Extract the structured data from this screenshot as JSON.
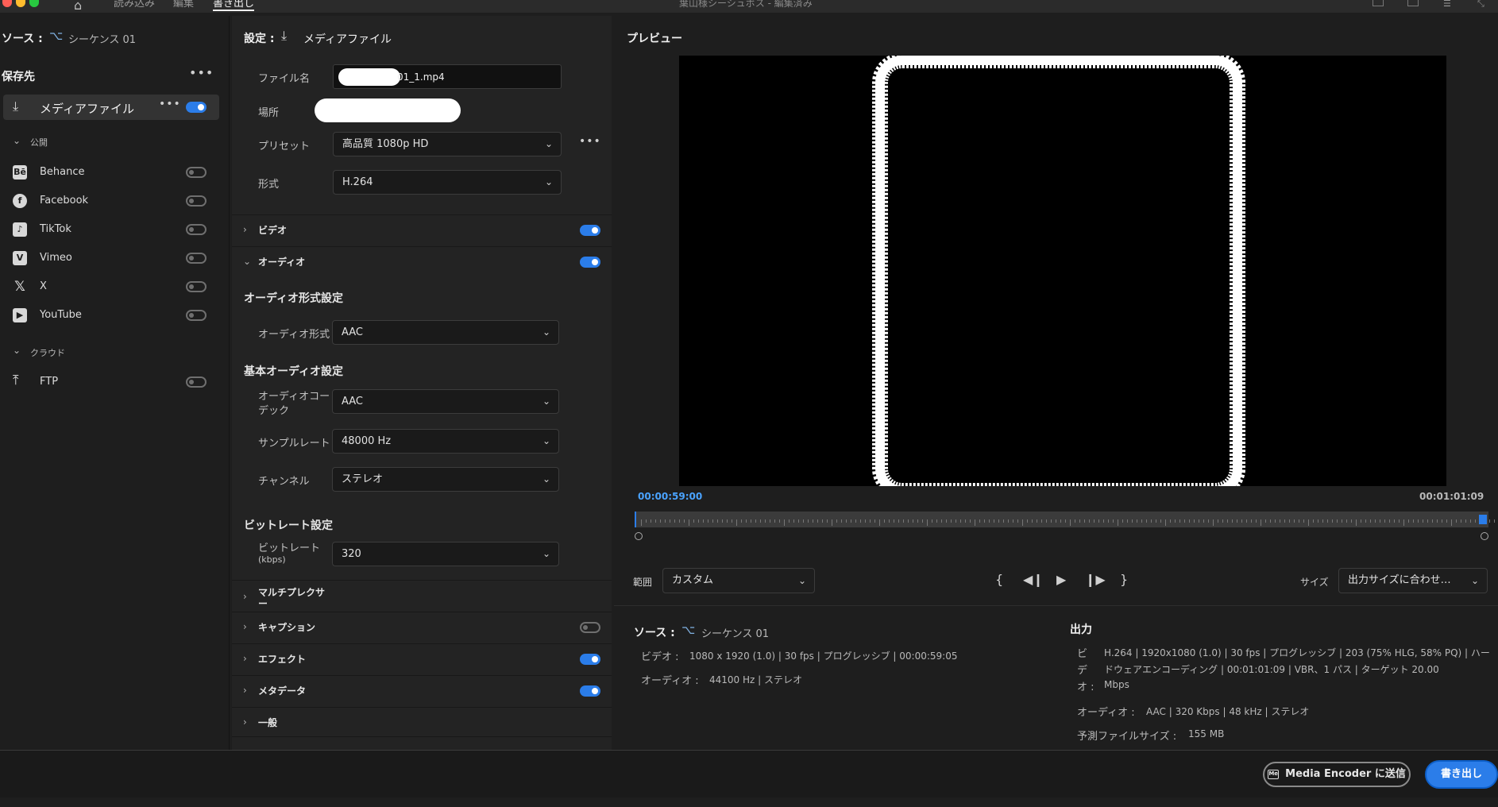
{
  "window_title": "葉山様シーシュボス - 編集済み",
  "nav": {
    "import": "読み込み",
    "edit": "編集",
    "export": "書き出し"
  },
  "source": {
    "label": "ソース :",
    "sequence": "シーケンス 01"
  },
  "destination": {
    "header": "保存先",
    "media_file": "メディアファイル",
    "publish_label": "公開",
    "platforms": [
      "Behance",
      "Facebook",
      "TikTok",
      "Vimeo",
      "X",
      "YouTube"
    ],
    "cloud_label": "クラウド",
    "cloud_items": [
      "FTP"
    ]
  },
  "settings": {
    "title": "設定 :",
    "media_file": "メディアファイル",
    "filename_label": "ファイル名",
    "filename_value": "01_1.mp4",
    "location_label": "場所",
    "preset_label": "プリセット",
    "preset_value": "高品質 1080p HD",
    "format_label": "形式",
    "format_value": "H.264",
    "video_section": "ビデオ",
    "audio_section": "オーディオ",
    "audio_format_header": "オーディオ形式設定",
    "audio_format_label": "オーディオ形式",
    "audio_format_value": "AAC",
    "basic_audio_header": "基本オーディオ設定",
    "audio_codec_label_1": "オーディオコー",
    "audio_codec_label_2": "デック",
    "audio_codec_value": "AAC",
    "sample_rate_label": "サンプルレート",
    "sample_rate_value": "48000 Hz",
    "channel_label": "チャンネル",
    "channel_value": "ステレオ",
    "bitrate_header": "ビットレート設定",
    "bitrate_label_1": "ビットレート",
    "bitrate_label_2": "(kbps)",
    "bitrate_value": "320",
    "multiplexer_1": "マルチプレクサ",
    "multiplexer_2": "ー",
    "caption": "キャプション",
    "effects": "エフェクト",
    "metadata": "メタデータ",
    "general": "一般"
  },
  "preview": {
    "title": "プレビュー",
    "timecode_current": "00:00:59:00",
    "timecode_end": "00:01:01:09",
    "range_label": "範囲",
    "range_value": "カスタム",
    "size_label": "サイズ",
    "size_value": "出力サイズに合わせ…"
  },
  "info": {
    "source_label": "ソース :",
    "source_seq": "シーケンス 01",
    "video_label": "ビデオ :",
    "video_value": "1080 x 1920 (1.0) | 30 fps | プログレッシブ | 00:00:59:05",
    "audio_label": "オーディオ :",
    "audio_value": "44100 Hz | ステレオ",
    "output_header": "出力",
    "out_video_label": [
      "ビ",
      "デ",
      "オ :"
    ],
    "out_video_line1": "H.264 | 1920x1080 (1.0) | 30 fps | プログレッシブ | 203 (75% HLG, 58% PQ) | ハー",
    "out_video_line2": "ドウェアエンコーディング | 00:01:01:09 | VBR、1 パス | ターゲット 20.00",
    "out_video_line3": "Mbps",
    "out_audio_label": "オーディオ :",
    "out_audio_value": "AAC | 320 Kbps | 48 kHz | ステレオ",
    "filesize_label": "予測ファイルサイズ :",
    "filesize_value": "155 MB"
  },
  "footer": {
    "media_encoder": "Media Encoder に送信",
    "export": "書き出し"
  },
  "colors": {
    "accent": "#2b7de9",
    "timecode": "#4aa3ff"
  }
}
